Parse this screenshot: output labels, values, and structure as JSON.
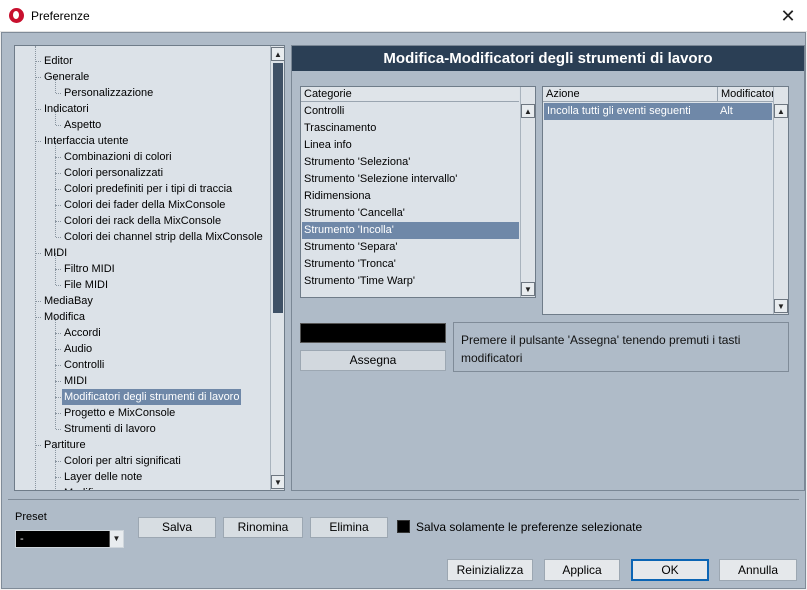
{
  "window": {
    "title": "Preferenze",
    "close_glyph": "✕"
  },
  "tree": {
    "items": [
      {
        "label": "Editor",
        "level": 0
      },
      {
        "label": "Generale",
        "level": 0
      },
      {
        "label": "Personalizzazione",
        "level": 1
      },
      {
        "label": "Indicatori",
        "level": 0
      },
      {
        "label": "Aspetto",
        "level": 1
      },
      {
        "label": "Interfaccia utente",
        "level": 0
      },
      {
        "label": "Combinazioni di colori",
        "level": 1
      },
      {
        "label": "Colori personalizzati",
        "level": 1
      },
      {
        "label": "Colori predefiniti per i tipi di traccia",
        "level": 1
      },
      {
        "label": "Colori dei fader della MixConsole",
        "level": 1
      },
      {
        "label": "Colori dei rack della MixConsole",
        "level": 1
      },
      {
        "label": "Colori dei channel strip della MixConsole",
        "level": 1
      },
      {
        "label": "MIDI",
        "level": 0
      },
      {
        "label": "Filtro MIDI",
        "level": 1
      },
      {
        "label": "File MIDI",
        "level": 1
      },
      {
        "label": "MediaBay",
        "level": 0
      },
      {
        "label": "Modifica",
        "level": 0
      },
      {
        "label": "Accordi",
        "level": 1
      },
      {
        "label": "Audio",
        "level": 1
      },
      {
        "label": "Controlli",
        "level": 1
      },
      {
        "label": "MIDI",
        "level": 1
      },
      {
        "label": "Modificatori degli strumenti di lavoro",
        "level": 1,
        "selected": true
      },
      {
        "label": "Progetto e MixConsole",
        "level": 1
      },
      {
        "label": "Strumenti di lavoro",
        "level": 1
      },
      {
        "label": "Partiture",
        "level": 0
      },
      {
        "label": "Colori per altri significati",
        "level": 1
      },
      {
        "label": "Layer delle note",
        "level": 1
      },
      {
        "label": "Modifica",
        "level": 1
      }
    ]
  },
  "panel": {
    "title": "Modifica-Modificatori degli strumenti di lavoro",
    "categories": {
      "header": "Categorie",
      "items": [
        "Controlli",
        "Trascinamento",
        "Linea info",
        "Strumento 'Seleziona'",
        "Strumento 'Selezione intervallo'",
        "Ridimensiona",
        "Strumento 'Cancella'",
        "Strumento 'Incolla'",
        "Strumento 'Separa'",
        "Strumento 'Tronca'",
        "Strumento 'Time Warp'"
      ],
      "selected_index": 7
    },
    "actions": {
      "header_action": "Azione",
      "header_modifiers": "Modificatori",
      "rows": [
        {
          "action": "Incolla tutti gli eventi seguenti",
          "modifier": "Alt"
        }
      ]
    },
    "modifier_field_value": "",
    "assign_label": "Assegna",
    "hint": "Premere il pulsante 'Assegna' tenendo premuti i tasti modificatori"
  },
  "preset": {
    "label": "Preset",
    "value": "-",
    "save_label": "Salva",
    "rename_label": "Rinomina",
    "delete_label": "Elimina",
    "save_only_label": "Salva solamente le preferenze selezionate",
    "save_only_checked": false
  },
  "footer": {
    "reset_label": "Reinizializza",
    "apply_label": "Applica",
    "ok_label": "OK",
    "cancel_label": "Annulla"
  },
  "icons": {
    "up_arrow": "▲",
    "down_arrow": "▼",
    "dropdown_arrow": "▼"
  },
  "colors": {
    "accent": "#2b3f55",
    "selection": "#6f88a8",
    "panel": "#afbbc8",
    "list_bg": "#dce2e8"
  }
}
